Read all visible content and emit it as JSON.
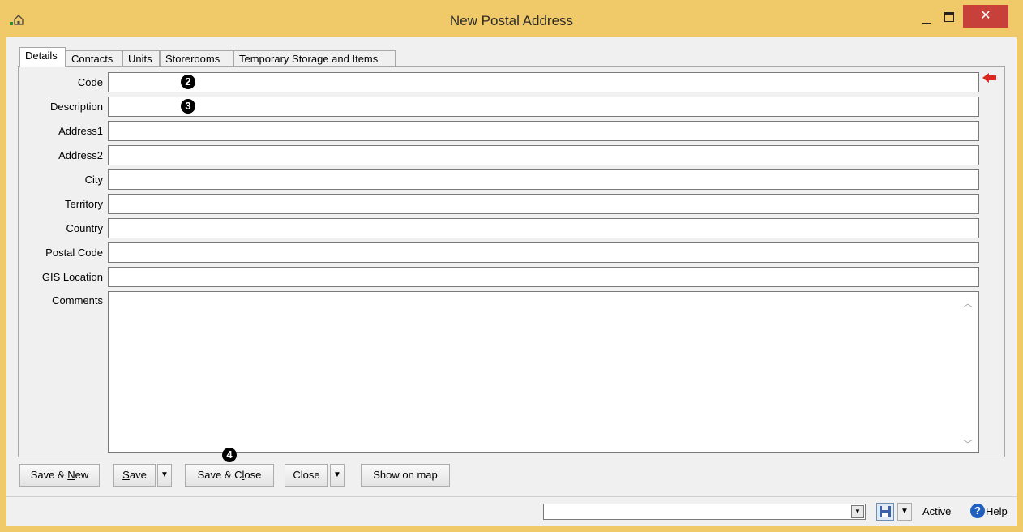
{
  "window": {
    "title": "New Postal Address",
    "icon": "house-icon",
    "close_glyph": "✕"
  },
  "tabs": [
    {
      "label": "Details",
      "active": true
    },
    {
      "label": "Contacts",
      "active": false
    },
    {
      "label": "Units",
      "active": false
    },
    {
      "label": "Storerooms",
      "active": false
    },
    {
      "label": "Temporary Storage and Items",
      "active": false
    }
  ],
  "fields": {
    "code": {
      "label": "Code",
      "value": ""
    },
    "description": {
      "label": "Description",
      "value": ""
    },
    "address1": {
      "label": "Address1",
      "value": ""
    },
    "address2": {
      "label": "Address2",
      "value": ""
    },
    "city": {
      "label": "City",
      "value": ""
    },
    "territory": {
      "label": "Territory",
      "value": ""
    },
    "country": {
      "label": "Country",
      "value": ""
    },
    "postal_code": {
      "label": "Postal Code",
      "value": ""
    },
    "gis_location": {
      "label": "GIS Location",
      "value": ""
    },
    "comments": {
      "label": "Comments",
      "value": ""
    }
  },
  "markers": {
    "code": "2",
    "description": "3",
    "save_close": "4"
  },
  "buttons": {
    "save_new": {
      "pre": "Save & ",
      "ul": "N",
      "post": "ew"
    },
    "save": {
      "pre": "",
      "ul": "S",
      "post": "ave"
    },
    "save_close": {
      "pre": "Save & C",
      "ul": "l",
      "post": "ose"
    },
    "close": "Close",
    "show_on_map": "Show on map",
    "dropdown_glyph": "▼"
  },
  "status": {
    "combo_value": "",
    "state": "Active",
    "help_label": "Help",
    "help_glyph": "?"
  },
  "colors": {
    "frame": "#f0c969",
    "close_button": "#c7403a",
    "required_marker": "#d82a1e",
    "help_icon": "#1f5fbf"
  }
}
